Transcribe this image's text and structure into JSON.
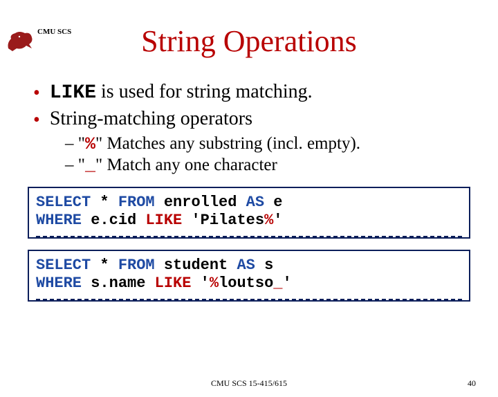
{
  "header": {
    "label": "CMU SCS"
  },
  "title": "String Operations",
  "bullets": [
    {
      "kw": "LIKE",
      "text": " is used for string matching."
    },
    {
      "text": "String-matching operators"
    }
  ],
  "subs": [
    {
      "prefix": "– \"",
      "sym": "%",
      "suffix": "\"  Matches any substring (incl. empty)."
    },
    {
      "prefix": "– \"",
      "sym": "_",
      "suffix": "\" Match any one character"
    }
  ],
  "code1": {
    "select": "SELECT",
    "star": " * ",
    "from": "FROM",
    "tail1": " enrolled ",
    "as": "AS",
    "alias": " e",
    "where": " WHERE",
    "col": " e.cid ",
    "like": "LIKE",
    "lit_pre": " 'Pilates",
    "esc": "%",
    "lit_post": "'"
  },
  "code2": {
    "select": "SELECT",
    "star": " * ",
    "from": "FROM",
    "tail1": " student ",
    "as": "AS",
    "alias": " s",
    "where": " WHERE",
    "col": " s.name ",
    "like": "LIKE",
    "lit_pre": " '",
    "esc1": "%",
    "mid": "loutso",
    "esc2": "_",
    "lit_post": "'"
  },
  "footer": {
    "course": "CMU SCS 15-415/615",
    "page": "40"
  }
}
